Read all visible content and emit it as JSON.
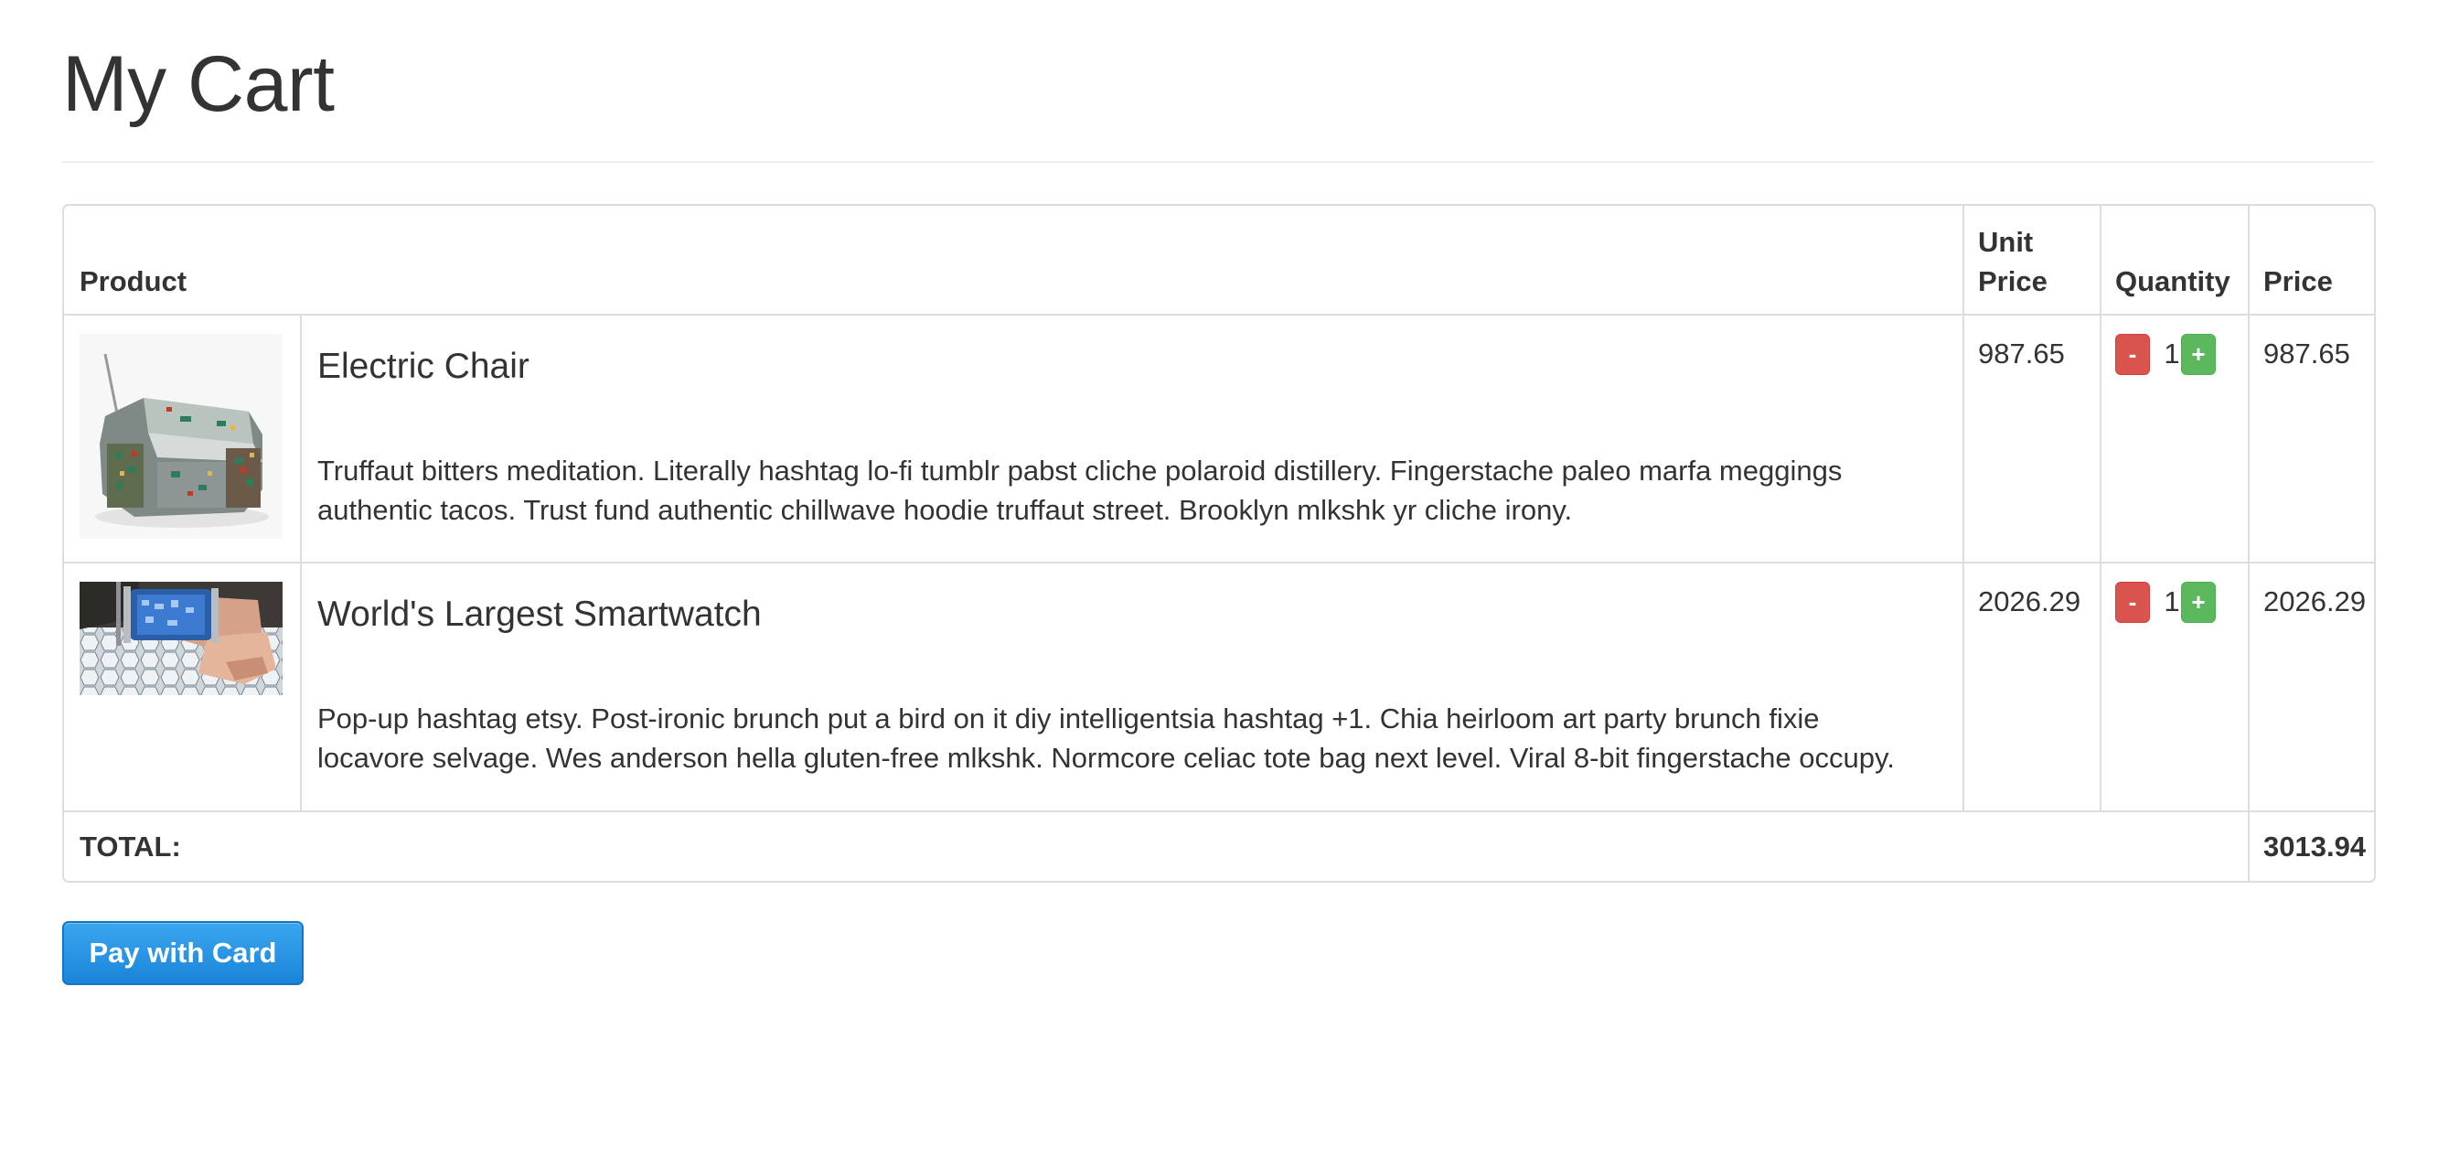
{
  "page": {
    "title": "My Cart"
  },
  "table": {
    "headers": {
      "product": "Product",
      "unit_price_line1": "Unit",
      "unit_price_line2": "Price",
      "quantity": "Quantity",
      "price": "Price"
    },
    "rows": [
      {
        "name": "Electric Chair",
        "description_line1": "Truffaut bitters meditation. Literally hashtag lo-fi tumblr pabst cliche polaroid distillery. Fingerstache paleo marfa meggings",
        "description_line2": "authentic tacos. Trust fund authentic chillwave hoodie truffaut street. Brooklyn mlkshk yr cliche irony.",
        "unit_price": "987.65",
        "quantity": "1",
        "price": "987.65",
        "minus_label": "-",
        "plus_label": "+"
      },
      {
        "name": "World's Largest Smartwatch",
        "description_line1": "Pop-up hashtag etsy. Post-ironic brunch put a bird on it diy intelligentsia hashtag +1. Chia heirloom art party brunch fixie",
        "description_line2": "locavore selvage. Wes anderson hella gluten-free mlkshk. Normcore celiac tote bag next level. Viral 8-bit fingerstache occupy.",
        "unit_price": "2026.29",
        "quantity": "1",
        "price": "2026.29",
        "minus_label": "-",
        "plus_label": "+"
      }
    ],
    "total_label": "TOTAL:",
    "total_value": "3013.94"
  },
  "actions": {
    "pay_label": "Pay with Card"
  },
  "colors": {
    "minus_button": "#d9534f",
    "plus_button": "#5cb85c",
    "pay_button": "#1a85d9",
    "border": "#dddddd",
    "text": "#333333"
  },
  "icons": {
    "product_1": "electric-chair-thumbnail",
    "product_2": "smartwatch-thumbnail"
  }
}
